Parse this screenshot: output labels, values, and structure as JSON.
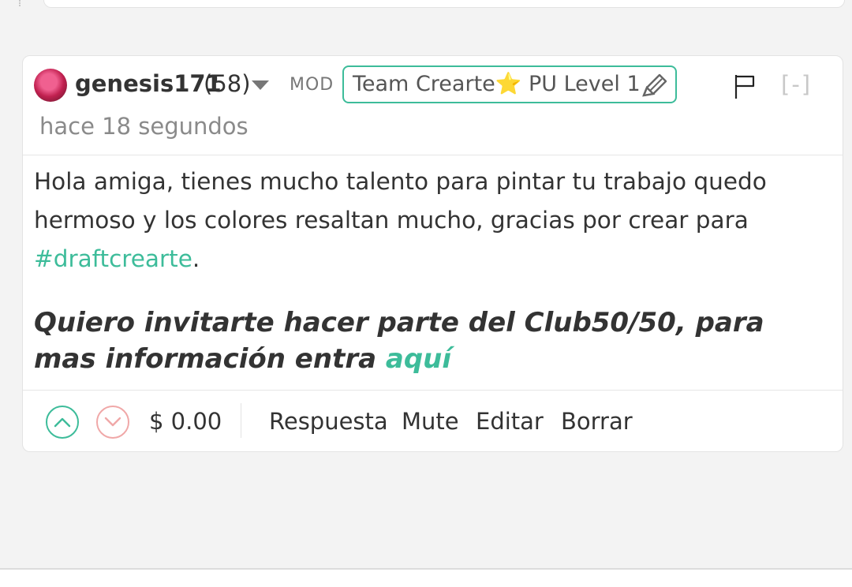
{
  "comment": {
    "author": "genesis171",
    "reputation": "(58)",
    "role": "MOD",
    "badge": {
      "text_before": "Team Crearte",
      "star": "⭐",
      "text_after": " PU Level 1"
    },
    "collapse_label": "[-]",
    "timestamp": "hace 18 segundos",
    "body_part1": "Hola amiga, tienes mucho talento para pintar tu trabajo quedo hermoso y los colores resaltan mucho, gracias por crear para ",
    "hashtag": "#draftcrearte",
    "body_part2": ".",
    "invite_text": "Quiero invitarte hacer parte del Club50/50, para mas información entra ",
    "invite_link": "aquí",
    "payout": "$ 0.00",
    "actions": {
      "reply": "Respuesta",
      "mute": "Mute",
      "edit": "Editar",
      "delete": "Borrar"
    }
  },
  "icons": {
    "menu": "chevron-down-icon",
    "flag": "flag-icon",
    "pencil": "pencil-icon",
    "upvote": "upvote-icon",
    "downvote": "downvote-icon"
  },
  "colors": {
    "accent": "#3dbc9a",
    "downvote": "#f0a8a8"
  }
}
